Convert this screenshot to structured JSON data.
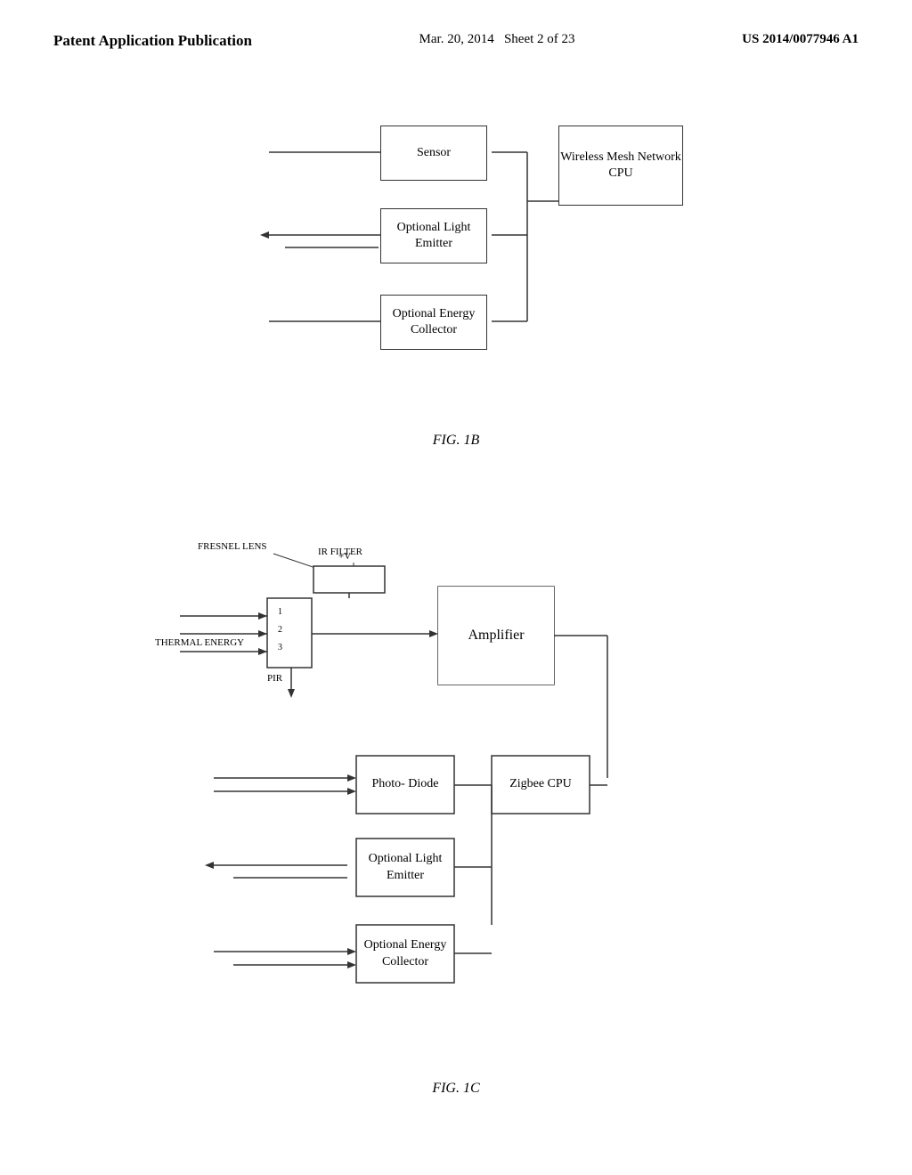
{
  "header": {
    "left": "Patent Application Publication",
    "center_line1": "Mar. 20, 2014",
    "center_line2": "Sheet 2 of 23",
    "right": "US 2014/0077946 A1"
  },
  "fig1b": {
    "label": "FIG. 1B",
    "boxes": {
      "sensor": "Sensor",
      "wireless": "Wireless Mesh\nNetwork CPU",
      "light_emitter": "Optional\nLight\nEmitter",
      "energy_collector": "Optional\nEnergy\nCollector"
    }
  },
  "fig1c": {
    "label": "FIG. 1C",
    "labels": {
      "fresnel": "FRESNEL LENS",
      "ir_filter": "IR FILTER",
      "thermal_energy": "THERMAL ENERGY",
      "pir": "PIR",
      "plus_v": "+V",
      "num1": "1",
      "num2": "2",
      "num3": "3"
    },
    "boxes": {
      "amplifier": "Amplifier",
      "photo_diode": "Photo-\nDiode",
      "zigbee": "Zigbee\nCPU",
      "light_emitter": "Optional\nLight\nEmitter",
      "energy_collector": "Optional\nEnergy\nCollector"
    }
  }
}
